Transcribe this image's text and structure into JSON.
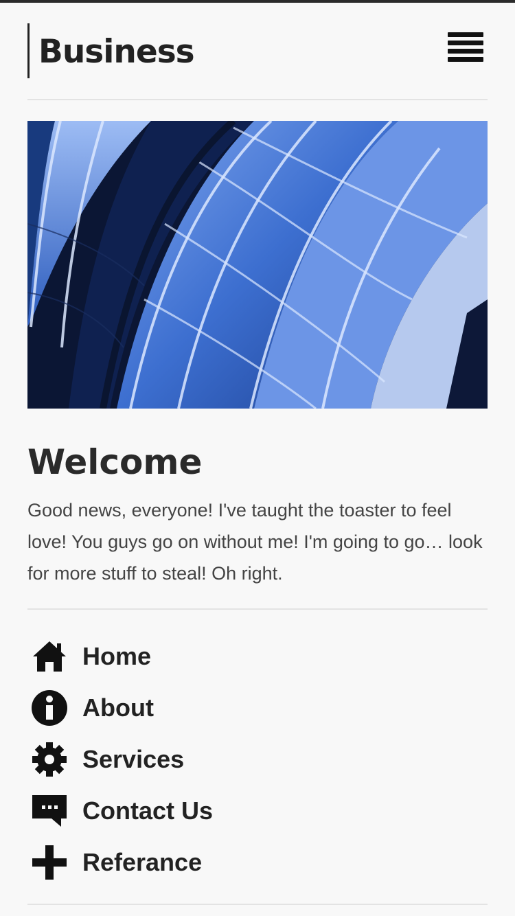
{
  "header": {
    "brand": "Business",
    "menu_icon": "hamburger-menu-icon"
  },
  "hero": {
    "image": "glass-building-facade-photo"
  },
  "main": {
    "title": "Welcome",
    "body": "Good news, everyone! I've taught the toaster to feel love! You guys go on without me! I'm going to go… look for more stuff to steal! Oh right."
  },
  "nav": {
    "items": [
      {
        "label": "Home",
        "icon": "home-icon"
      },
      {
        "label": "About",
        "icon": "info-icon"
      },
      {
        "label": "Services",
        "icon": "gear-icon"
      },
      {
        "label": "Contact Us",
        "icon": "chat-icon"
      },
      {
        "label": "Referance",
        "icon": "plus-icon"
      }
    ]
  },
  "colors": {
    "background": "#f8f8f8",
    "text": "#222222",
    "divider": "#e3e3e3",
    "hero_blue": "#3a6fd1"
  }
}
